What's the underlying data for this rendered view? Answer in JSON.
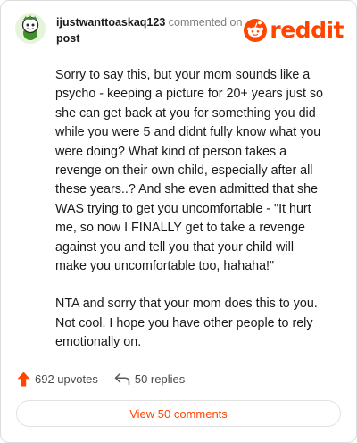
{
  "comment": {
    "username": "ijustwanttoaskaq123",
    "commented_on": "commented on",
    "post_label": "post",
    "paragraphs": [
      "Sorry to say this, but your mom sounds like a psycho - keeping a picture for 20+ years just so she can get back at you for something you did while you were 5 and didnt fully know what you were doing? What kind of person takes a revenge on their own child, especially after all these years..? And she even admitted that she WAS trying to get you uncomfortable - \"It hurt me, so now I FINALLY get to take a revenge against you and tell you that your child will make you uncomfortable too, hahaha!\"",
      "NTA and sorry that your mom does this to you. Not cool. I hope you have other people to rely emotionally on."
    ]
  },
  "brand": {
    "name": "reddit",
    "color": "#ff4500",
    "icon": "reddit-snoo-icon"
  },
  "actions": {
    "upvotes": "692 upvotes",
    "replies": "50 replies",
    "upvote_icon": "upvote-arrow-icon",
    "reply_icon": "reply-arrow-icon"
  },
  "view_comments": "View 50 comments",
  "colors": {
    "accent": "#ff4500",
    "avatar_bg": "#e6f4dc",
    "avatar_figure": "#3f8f2a"
  }
}
